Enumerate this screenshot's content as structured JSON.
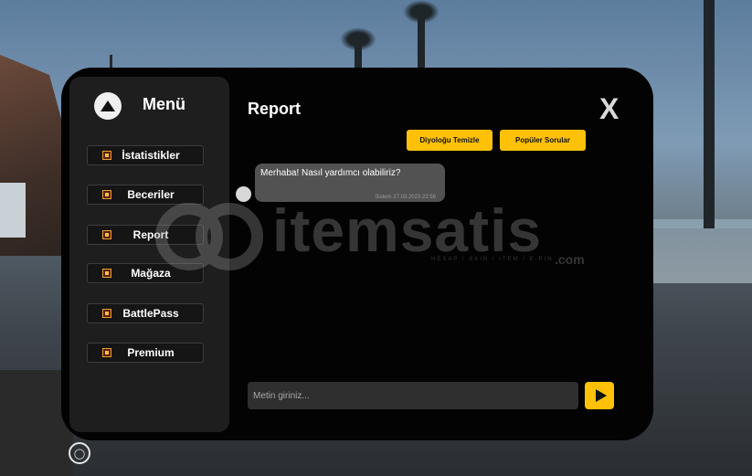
{
  "sidebar": {
    "title": "Menü",
    "items": [
      {
        "label": "İstatistikler",
        "icon": "stats-icon"
      },
      {
        "label": "Beceriler",
        "icon": "skills-icon"
      },
      {
        "label": "Report",
        "icon": "report-icon"
      },
      {
        "label": "Mağaza",
        "icon": "store-icon"
      },
      {
        "label": "BattlePass",
        "icon": "battlepass-icon"
      },
      {
        "label": "Premium",
        "icon": "premium-icon"
      }
    ]
  },
  "main": {
    "title": "Report",
    "close_label": "X",
    "clear_button": "Diyoloğu Temizle",
    "faq_button": "Popüler Sorular",
    "messages": [
      {
        "text": "Merhaba! Nasıl yardımcı olabiliriz?",
        "meta": "Sistem 27.03.2023 22:56"
      }
    ],
    "input": {
      "placeholder": "Metin giriniz...",
      "value": ""
    }
  },
  "watermark": {
    "brand": "itemsatis",
    "tagline": "HESAP / SKIN / ITEM / E-PIN",
    "tld": ".com"
  },
  "colors": {
    "accent": "#ffc107",
    "window_bg": "#030303",
    "sidebar_bg": "#1e1e1e",
    "bubble_bg": "#525252"
  }
}
